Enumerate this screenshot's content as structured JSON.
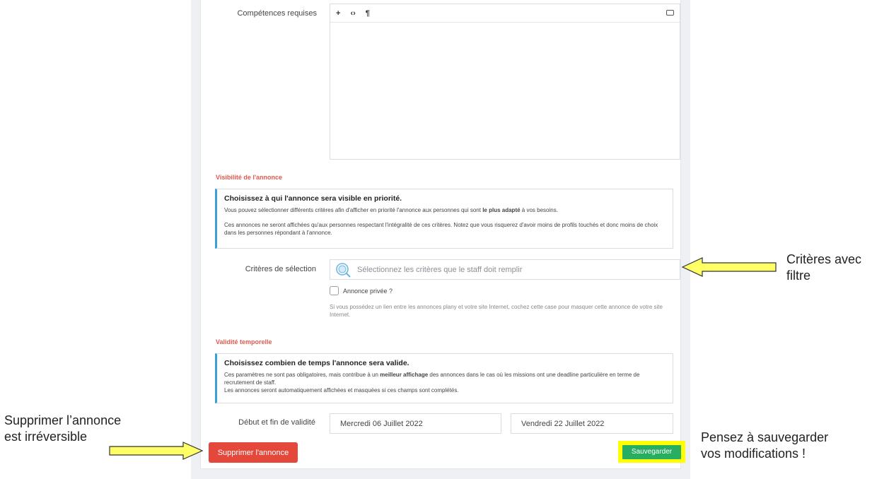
{
  "form": {
    "skills_label": "Compétences requises",
    "editor_toolbar": {
      "plus": "+",
      "code": "‹›",
      "pilcrow": "¶"
    },
    "visibility": {
      "section_title": "Visibilité de l'annonce",
      "box_title": "Choisissez à qui l'annonce sera visible en priorité.",
      "p1_before": "Vous pouvez sélectionner différents critères afin d'afficher en priorité l'annonce aux personnes qui sont ",
      "p1_bold": "le plus adapté",
      "p1_after": " à vos besoins.",
      "p2": "Ces annonces ne seront affichées qu'aux personnes respectant l'intégralité de ces critères. Notez que vous risquerez d'avoir moins de profils touchés et donc moins de choix dans les personnes répondant à l'annonce."
    },
    "criteria_label": "Critères de sélection",
    "criteria_placeholder": "Sélectionnez les critères que le staff doit remplir",
    "private_label": "Annonce privée ?",
    "private_help": "Si vous possédez un lien entre les annonces plany et votre site Internet, cochez cette case pour masquer cette annonce de votre site Internet.",
    "validity": {
      "section_title": "Validité temporelle",
      "box_title": "Choisissez combien de temps l'annonce sera valide.",
      "p1_before": "Ces paramètres ne sont pas obligatoires, mais contribue à un ",
      "p1_bold": "meilleur affichage",
      "p1_after": " des annonces dans le cas où les missions ont une deadline particulière en terme de recrutement de staff.",
      "p2": "Les annonces seront automatiquement affichées et masquées si ces champs sont complétés."
    },
    "dates_label": "Début et fin de validité",
    "start_date": "Mercredi 06 Juillet 2022",
    "end_date": "Vendredi 22 Juillet 2022",
    "delete_button": "Supprimer l'annonce",
    "save_button": "Sauvegarder"
  },
  "annotations": {
    "criteria_line1": "Critères avec",
    "criteria_line2": "filtre",
    "delete_line1": "Supprimer l’annonce",
    "delete_line2": "est irréversible",
    "save_line1": "Pensez à sauvegarder",
    "save_line2": "vos modifications !"
  },
  "colors": {
    "section_title": "#e05a4f",
    "info_border": "#3aa0d8",
    "danger": "#e4483b",
    "success": "#27ae60",
    "highlight": "#ffff00"
  }
}
